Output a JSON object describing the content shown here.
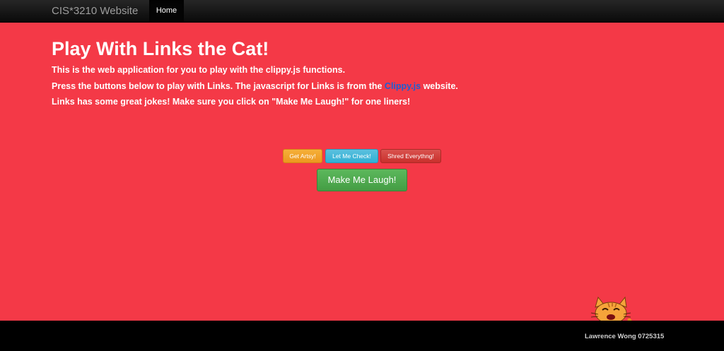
{
  "navbar": {
    "brand": "CIS*3210 Website",
    "home_label": "Home"
  },
  "main": {
    "title": "Play With Links the Cat!",
    "line1": "This is the web application for you to play with the clippy.js functions.",
    "line2_before": "Press the buttons below to play with Links. The javascript for Links is from the ",
    "line2_link": "Clippy.js",
    "line2_after": " website.",
    "line3": "Links has some great jokes! Make sure you click on \"Make Me Laugh!\" for one liners!"
  },
  "buttons": {
    "artsy": "Get Artsy!",
    "check": "Let Me Check!",
    "shred": "Shred Everythng!",
    "laugh": "Make Me Laugh!"
  },
  "agent": {
    "name": "Links",
    "icon": "cat-agent-icon"
  },
  "footer": {
    "text": "Lawrence Wong 0725315"
  },
  "colors": {
    "background": "#f43947",
    "navbar": "#1b1b1b",
    "footer": "#000000",
    "link": "#1a5fd6",
    "warning": "#f0ad4e",
    "info": "#5bc0de",
    "danger": "#d9534f",
    "success": "#5cb85c"
  }
}
